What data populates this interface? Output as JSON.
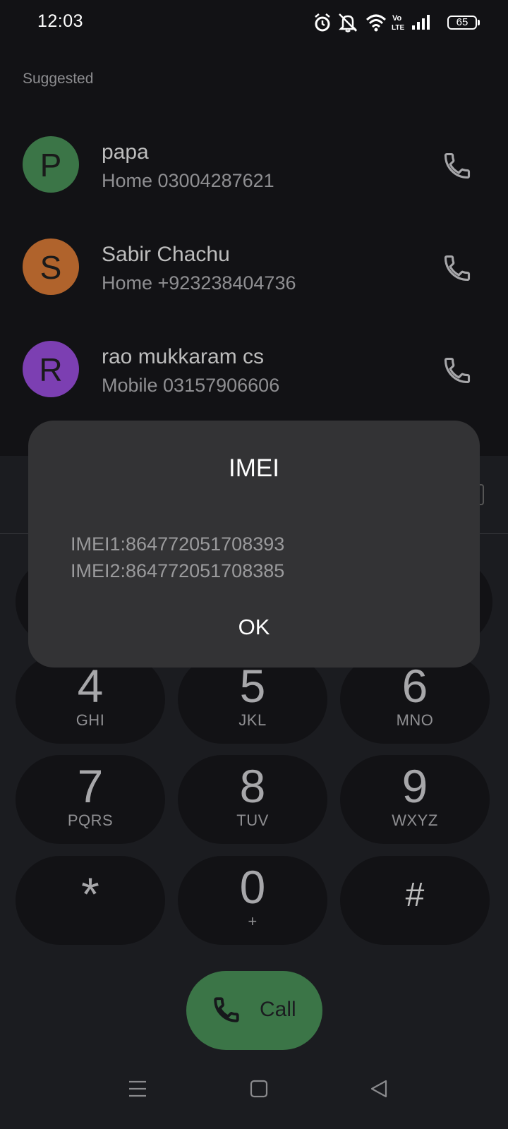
{
  "status_bar": {
    "time": "12:03",
    "battery_level": "65",
    "icons": [
      "alarm-icon",
      "bell-muted-icon",
      "wifi-icon",
      "volte-icon",
      "signal-icon",
      "battery-icon"
    ],
    "volte_label_top": "Vo",
    "volte_label_bottom": "LTE"
  },
  "suggested": {
    "title": "Suggested",
    "contacts": [
      {
        "initial": "P",
        "name": "papa",
        "detail": "Home 03004287621",
        "avatar_color": "#3b7547"
      },
      {
        "initial": "S",
        "name": "Sabir Chachu",
        "detail": "Home +923238404736",
        "avatar_color": "#b0632c"
      },
      {
        "initial": "R",
        "name": "rao mukkaram cs",
        "detail": "Mobile 03157906606",
        "avatar_color": "#7c3fb2"
      }
    ]
  },
  "dialpad": {
    "keys": [
      {
        "digit": "4",
        "letters": "GHI"
      },
      {
        "digit": "5",
        "letters": "JKL"
      },
      {
        "digit": "6",
        "letters": "MNO"
      },
      {
        "digit": "7",
        "letters": "PQRS"
      },
      {
        "digit": "8",
        "letters": "TUV"
      },
      {
        "digit": "9",
        "letters": "WXYZ"
      },
      {
        "digit": "*",
        "letters": ""
      },
      {
        "digit": "0",
        "letters": "+"
      },
      {
        "digit": "#",
        "letters": ""
      }
    ],
    "call_label": "Call"
  },
  "dialog": {
    "title": "IMEI",
    "imei1": "IMEI1:864772051708393",
    "imei2": "IMEI2:864772051708385",
    "ok_label": "OK"
  },
  "colors": {
    "background": "#1b1c20",
    "panel": "#121215",
    "dialog": "#333335",
    "call_green": "#3b7547"
  }
}
